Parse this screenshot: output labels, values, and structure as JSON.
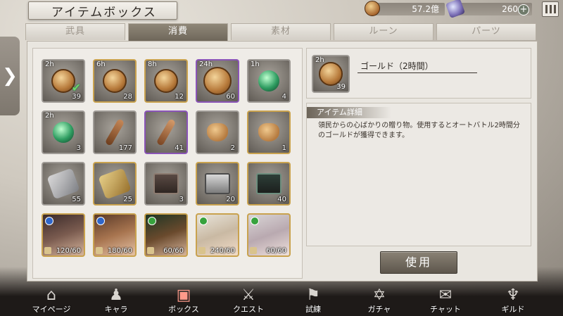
{
  "header": {
    "title": "アイテムボックス",
    "gold_amount": "57.2億",
    "gem_amount": "260",
    "plus_label": "+"
  },
  "tabs": [
    "武具",
    "消費",
    "素材",
    "ルーン",
    "パーツ"
  ],
  "active_tab": "消費",
  "side_arrow": "❯",
  "items": [
    {
      "duration": "2h",
      "qty": "39",
      "icon": "gold-coin-icon",
      "frame": "silver",
      "selected": true
    },
    {
      "duration": "6h",
      "qty": "28",
      "icon": "gold-coin-icon",
      "frame": "gold"
    },
    {
      "duration": "8h",
      "qty": "12",
      "icon": "gold-coin-icon",
      "frame": "gold"
    },
    {
      "duration": "24h",
      "qty": "60",
      "icon": "gold-coin-icon",
      "frame": "purple"
    },
    {
      "duration": "1h",
      "qty": "4",
      "icon": "green-orb-icon",
      "frame": "silver"
    },
    {
      "duration": "2h",
      "qty": "3",
      "icon": "green-orb-icon",
      "frame": "silver"
    },
    {
      "duration": "",
      "qty": "177",
      "icon": "key-icon",
      "frame": "silver"
    },
    {
      "duration": "",
      "qty": "41",
      "icon": "key-icon",
      "frame": "purple"
    },
    {
      "duration": "",
      "qty": "2",
      "icon": "pouch-icon",
      "frame": "silver"
    },
    {
      "duration": "",
      "qty": "1",
      "icon": "pouch-icon",
      "frame": "gold"
    },
    {
      "duration": "",
      "qty": "55",
      "icon": "silver-scroll-icon",
      "frame": "silver"
    },
    {
      "duration": "",
      "qty": "25",
      "icon": "gold-scroll-icon",
      "frame": "gold"
    },
    {
      "duration": "",
      "qty": "3",
      "icon": "chest-icon",
      "frame": "silver"
    },
    {
      "duration": "",
      "qty": "20",
      "icon": "white-chest-icon",
      "frame": "gold"
    },
    {
      "duration": "",
      "qty": "40",
      "icon": "green-chest-icon",
      "frame": "gold"
    },
    {
      "duration": "",
      "qty": "120/60",
      "icon": "character-portrait-icon",
      "frame": "gold",
      "element": "water"
    },
    {
      "duration": "",
      "qty": "180/60",
      "icon": "character-portrait-icon",
      "frame": "gold",
      "element": "water"
    },
    {
      "duration": "",
      "qty": "60/60",
      "icon": "character-portrait-icon",
      "frame": "gold",
      "element": "wind"
    },
    {
      "duration": "",
      "qty": "240/60",
      "icon": "character-portrait-icon",
      "frame": "gold",
      "element": "wind"
    },
    {
      "duration": "",
      "qty": "60/60",
      "icon": "character-portrait-icon",
      "frame": "gold",
      "element": "wind"
    }
  ],
  "detail": {
    "duration": "2h",
    "qty": "39",
    "name": "ゴールド（2時間）",
    "section_title": "アイテム詳細",
    "description": "領民からの心ばかりの贈り物。使用するとオートバトル2時間分のゴールドが獲得できます。",
    "use_button": "使用"
  },
  "nav": [
    {
      "label": "マイページ",
      "icon": "home-icon",
      "glyph": "⌂"
    },
    {
      "label": "キャラ",
      "icon": "characters-icon",
      "glyph": "♟"
    },
    {
      "label": "ボックス",
      "icon": "box-icon",
      "glyph": "▣",
      "active": true
    },
    {
      "label": "クエスト",
      "icon": "crossed-swords-icon",
      "glyph": "⚔"
    },
    {
      "label": "試練",
      "icon": "flag-icon",
      "glyph": "⚑"
    },
    {
      "label": "ガチャ",
      "icon": "gacha-star-icon",
      "glyph": "✡"
    },
    {
      "label": "チャット",
      "icon": "chat-icon",
      "glyph": "✉"
    },
    {
      "label": "ギルド",
      "icon": "guild-icon",
      "glyph": "♆"
    }
  ]
}
